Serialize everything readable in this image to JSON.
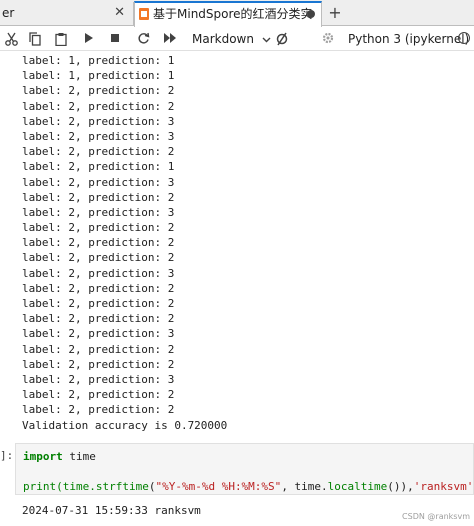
{
  "tabs": {
    "prev_label": "er",
    "prev_close": "✕",
    "active_label": "基于MindSpore的红酒分类实",
    "add": "+"
  },
  "toolbar": {
    "kernel_type": "Markdown",
    "kernel_name": "Python 3 (ipykernel)"
  },
  "output_lines": [
    "label: 1, prediction: 1",
    "label: 1, prediction: 1",
    "label: 2, prediction: 2",
    "label: 2, prediction: 2",
    "label: 2, prediction: 3",
    "label: 2, prediction: 3",
    "label: 2, prediction: 2",
    "label: 2, prediction: 1",
    "label: 2, prediction: 3",
    "label: 2, prediction: 2",
    "label: 2, prediction: 3",
    "label: 2, prediction: 2",
    "label: 2, prediction: 2",
    "label: 2, prediction: 2",
    "label: 2, prediction: 3",
    "label: 2, prediction: 2",
    "label: 2, prediction: 2",
    "label: 2, prediction: 2",
    "label: 2, prediction: 3",
    "label: 2, prediction: 2",
    "label: 2, prediction: 2",
    "label: 2, prediction: 3",
    "label: 2, prediction: 2",
    "label: 2, prediction: 2",
    "Validation accuracy is 0.720000"
  ],
  "cell": {
    "prompt": "]:",
    "line1": {
      "kw": "import",
      "rest": " time"
    },
    "line2": {
      "p1": "print(time.",
      "p2": "strftime",
      "p3": "(",
      "p4": "\"%Y-%m-%d %H:%M:%S\"",
      "p5": ", time.",
      "p6": "localtime",
      "p7": "()),",
      "p8": "'ranksvm'",
      "p9": ")"
    }
  },
  "result": "2024-07-31 15:59:33 ranksvm",
  "watermark": "CSDN @ranksvm"
}
